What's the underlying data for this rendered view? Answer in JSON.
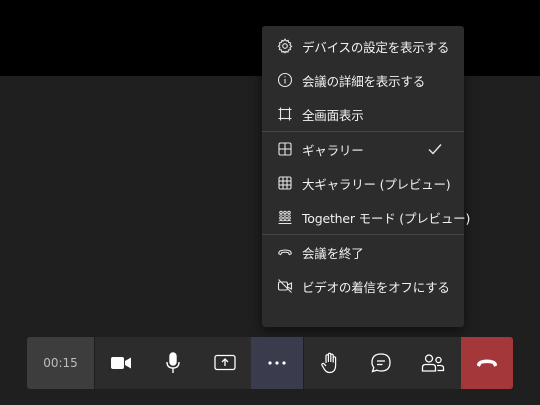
{
  "meeting": {
    "timer": "00:15"
  },
  "menu": {
    "items": [
      {
        "label": "デバイスの設定を表示する",
        "icon": "gear-icon"
      },
      {
        "label": "会議の詳細を表示する",
        "icon": "info-icon"
      },
      {
        "label": "全画面表示",
        "icon": "fullscreen-icon"
      },
      {
        "label": "ギャラリー",
        "icon": "grid-2x2-icon",
        "checked": true
      },
      {
        "label": "大ギャラリー (プレビュー)",
        "icon": "grid-3x3-icon"
      },
      {
        "label": "Together モード (プレビュー)",
        "icon": "together-mode-icon"
      },
      {
        "label": "会議を終了",
        "icon": "end-meeting-icon"
      },
      {
        "label": "ビデオの着信をオフにする",
        "icon": "video-off-icon"
      }
    ]
  },
  "toolbar": {
    "buttons": [
      {
        "name": "camera-button",
        "icon": "camera-icon"
      },
      {
        "name": "microphone-button",
        "icon": "microphone-icon"
      },
      {
        "name": "share-screen-button",
        "icon": "share-screen-icon"
      },
      {
        "name": "more-options-button",
        "icon": "more-icon",
        "active": true
      },
      {
        "name": "raise-hand-button",
        "icon": "hand-icon"
      },
      {
        "name": "chat-button",
        "icon": "chat-icon"
      },
      {
        "name": "participants-button",
        "icon": "people-icon"
      },
      {
        "name": "hangup-button",
        "icon": "phone-hangup-icon"
      }
    ]
  },
  "colors": {
    "background": "#1f1f1f",
    "menu_bg": "#2d2c2c",
    "active_btn": "#3b3b4e",
    "hangup": "#a4373a"
  }
}
